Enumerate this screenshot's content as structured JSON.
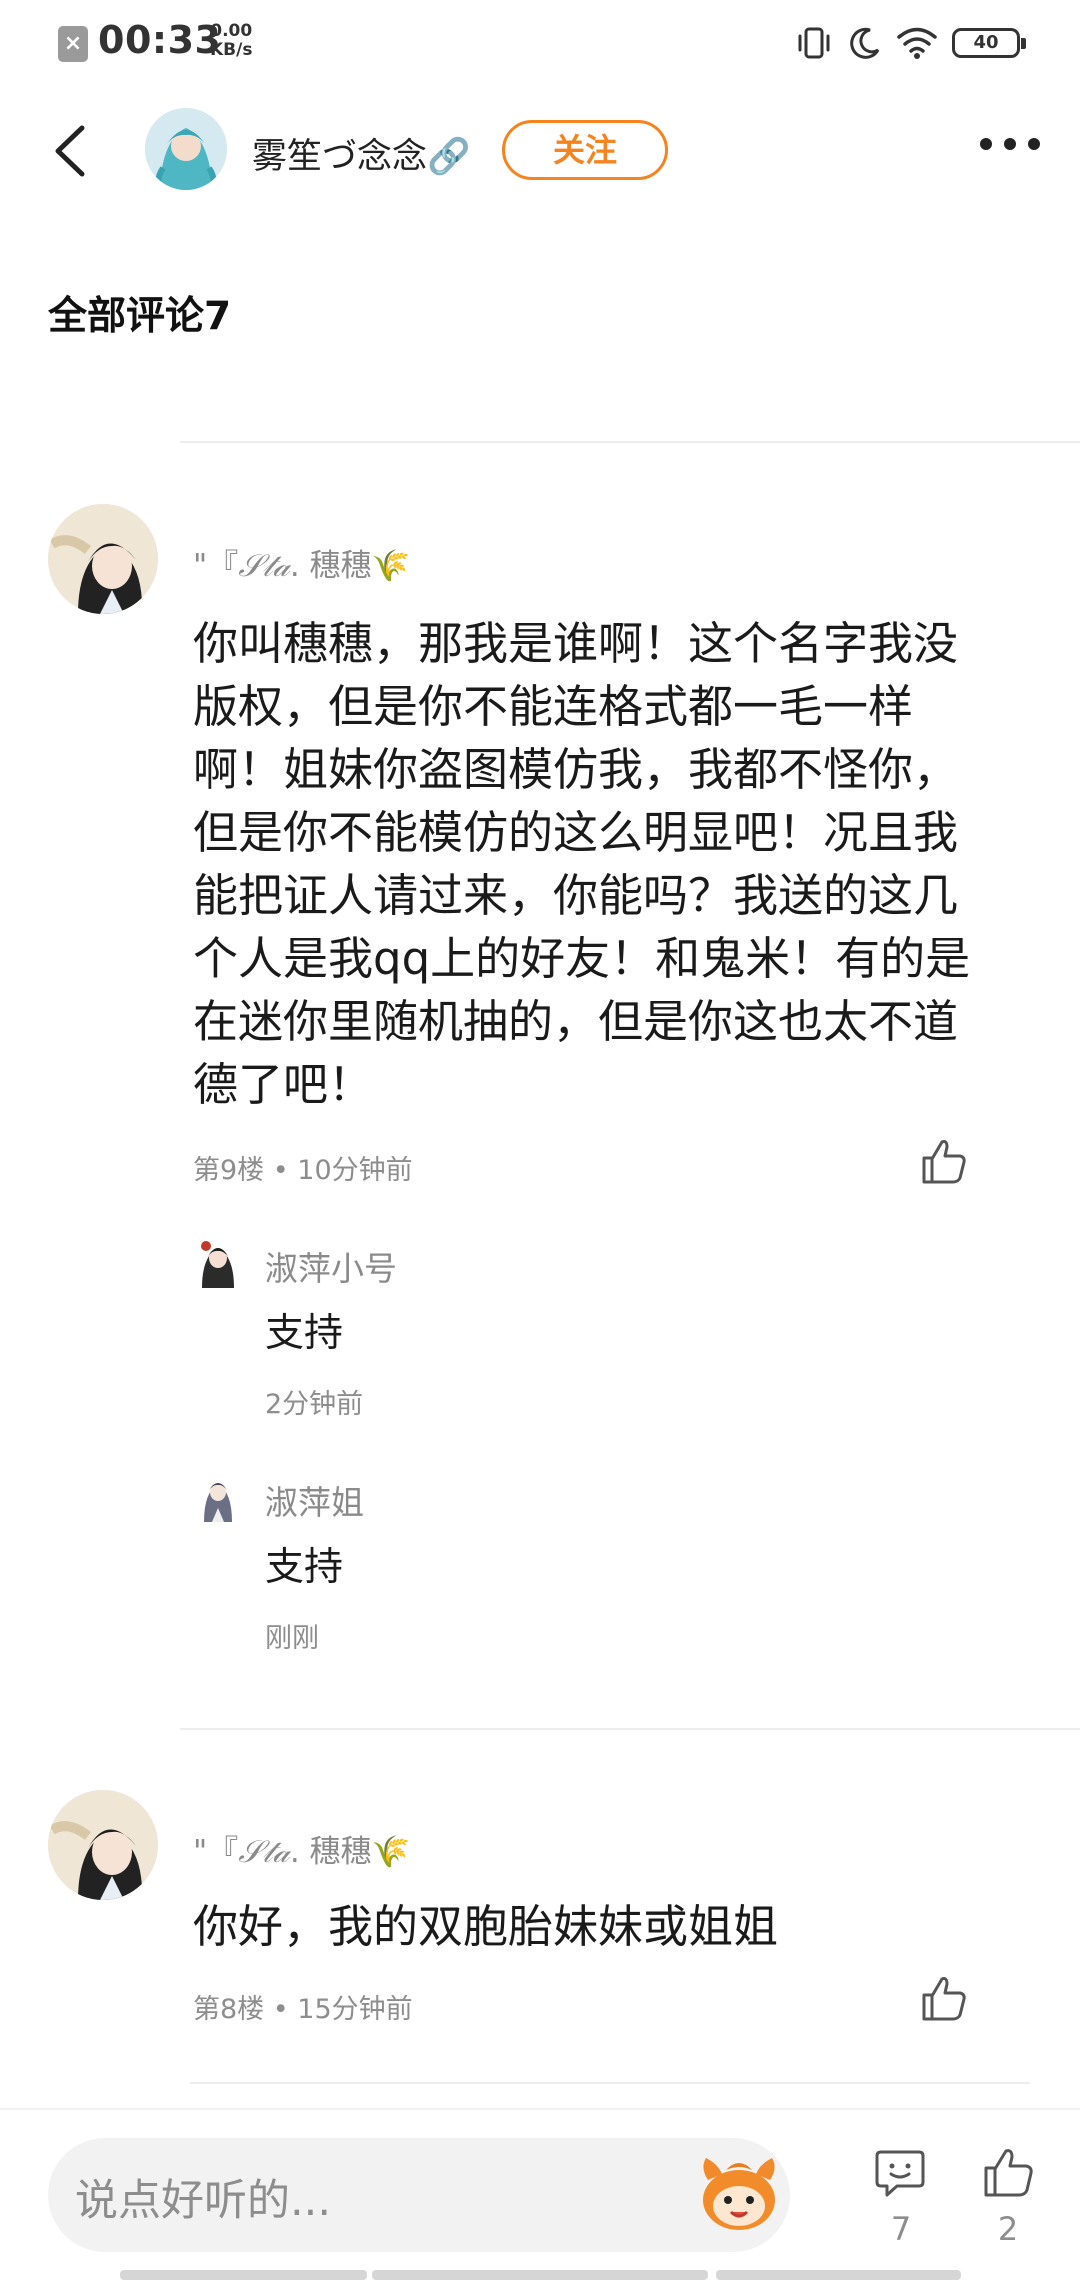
{
  "status_bar": {
    "time": "00:33",
    "speed_value": "0.00",
    "speed_unit": "KB/s",
    "battery": "40"
  },
  "header": {
    "username": "雾笙づ念念🔗",
    "follow_label": "关注"
  },
  "section_title": "全部评论7",
  "comments": [
    {
      "author_prefix": "\"『",
      "author_deco": "𝒮𝓉𝒶",
      "author_suffix": ". 穗穗🌾",
      "body": "你叫穗穗，那我是谁啊！这个名字我没版权，但是你不能连格式都一毛一样啊！姐妹你盗图模仿我，我都不怪你，但是你不能模仿的这么明显吧！况且我能把证人请过来，你能吗？我送的这几个人是我qq上的好友！和鬼米！有的是在迷你里随机抽的，但是你这也太不道德了吧！",
      "meta": "第9楼 • 10分钟前",
      "replies": [
        {
          "name": "淑萍小号",
          "body": "支持",
          "time": "2分钟前"
        },
        {
          "name": "淑萍姐",
          "body": "支持",
          "time": "刚刚"
        }
      ]
    },
    {
      "author_prefix": "\"『",
      "author_deco": "𝒮𝓉𝒶",
      "author_suffix": ". 穗穗🌾",
      "body": "你好，我的双胞胎妹妹或姐姐",
      "meta": "第8楼 • 15分钟前"
    }
  ],
  "bottom": {
    "input_placeholder": "说点好听的...",
    "comment_count": "7",
    "like_count": "2"
  },
  "colors": {
    "accent": "#f5831e",
    "secondary_text": "#8d8d8d"
  }
}
